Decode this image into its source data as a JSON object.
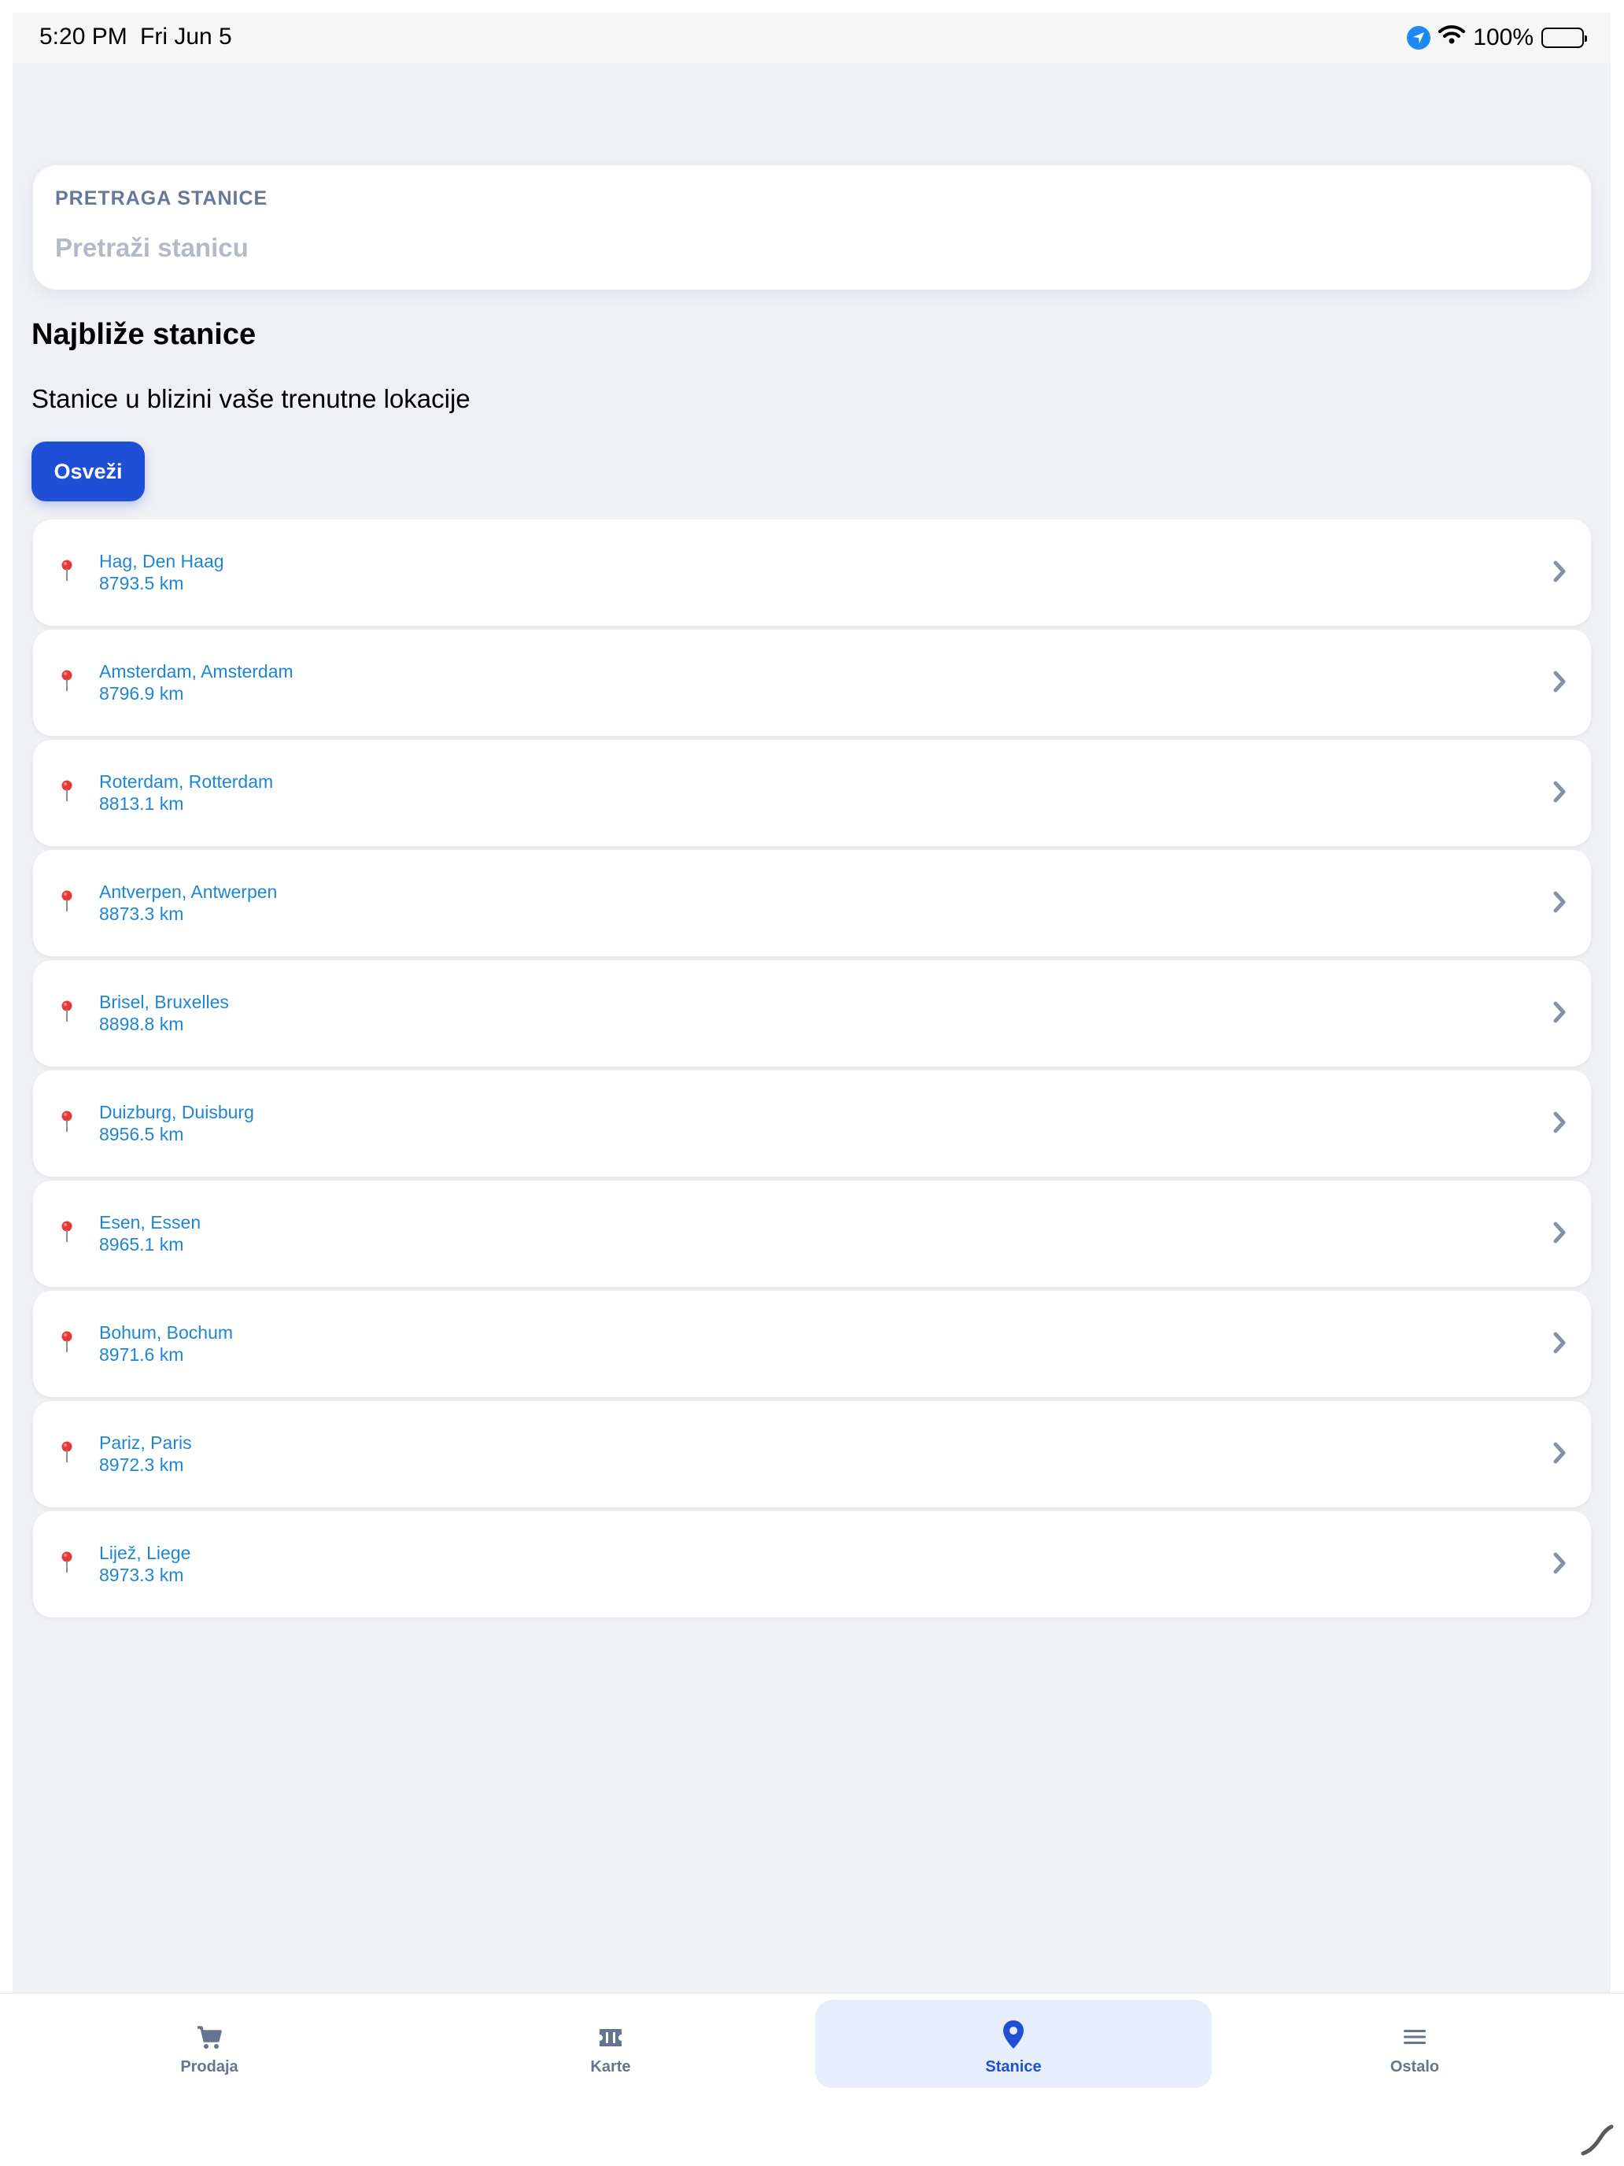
{
  "status_bar": {
    "time": "5:20 PM",
    "date": "Fri Jun 5",
    "battery": "100%"
  },
  "search": {
    "label": "PRETRAGA STANICE",
    "placeholder": "Pretraži stanicu"
  },
  "section": {
    "title": "Najbliže stanice",
    "subtitle": "Stanice u blizini vaše trenutne lokacije",
    "refresh_label": "Osveži"
  },
  "stations": [
    {
      "name": "Hag, Den Haag",
      "distance": "8793.5 km"
    },
    {
      "name": "Amsterdam, Amsterdam",
      "distance": "8796.9 km"
    },
    {
      "name": "Roterdam, Rotterdam",
      "distance": "8813.1 km"
    },
    {
      "name": "Antverpen, Antwerpen",
      "distance": "8873.3 km"
    },
    {
      "name": "Brisel, Bruxelles",
      "distance": "8898.8 km"
    },
    {
      "name": "Duizburg, Duisburg",
      "distance": "8956.5 km"
    },
    {
      "name": "Esen, Essen",
      "distance": "8965.1 km"
    },
    {
      "name": "Bohum, Bochum",
      "distance": "8971.6 km"
    },
    {
      "name": "Pariz, Paris",
      "distance": "8972.3 km"
    },
    {
      "name": "Lijež, Liege",
      "distance": "8973.3 km"
    }
  ],
  "tabs": [
    {
      "label": "Prodaja",
      "icon": "cart-icon",
      "active": false
    },
    {
      "label": "Karte",
      "icon": "ticket-icon",
      "active": false
    },
    {
      "label": "Stanice",
      "icon": "map-pin-icon",
      "active": true
    },
    {
      "label": "Ostalo",
      "icon": "menu-icon",
      "active": false
    }
  ],
  "colors": {
    "accent": "#1f4fd6",
    "link": "#1e86d6",
    "background": "#eff1f5",
    "pin": "#e53935"
  }
}
